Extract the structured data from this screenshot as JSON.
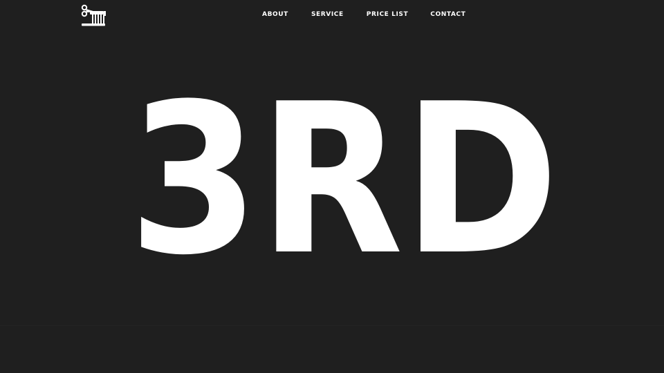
{
  "logo": {
    "icon": "scissors-comb-icon"
  },
  "nav": {
    "items": [
      {
        "label": "ABOUT"
      },
      {
        "label": "SERVICE"
      },
      {
        "label": "PRICE LIST"
      },
      {
        "label": "CONTACT"
      }
    ]
  },
  "hero": {
    "title": "3RD"
  },
  "colors": {
    "background": "#1f1f1f",
    "text": "#ffffff"
  }
}
